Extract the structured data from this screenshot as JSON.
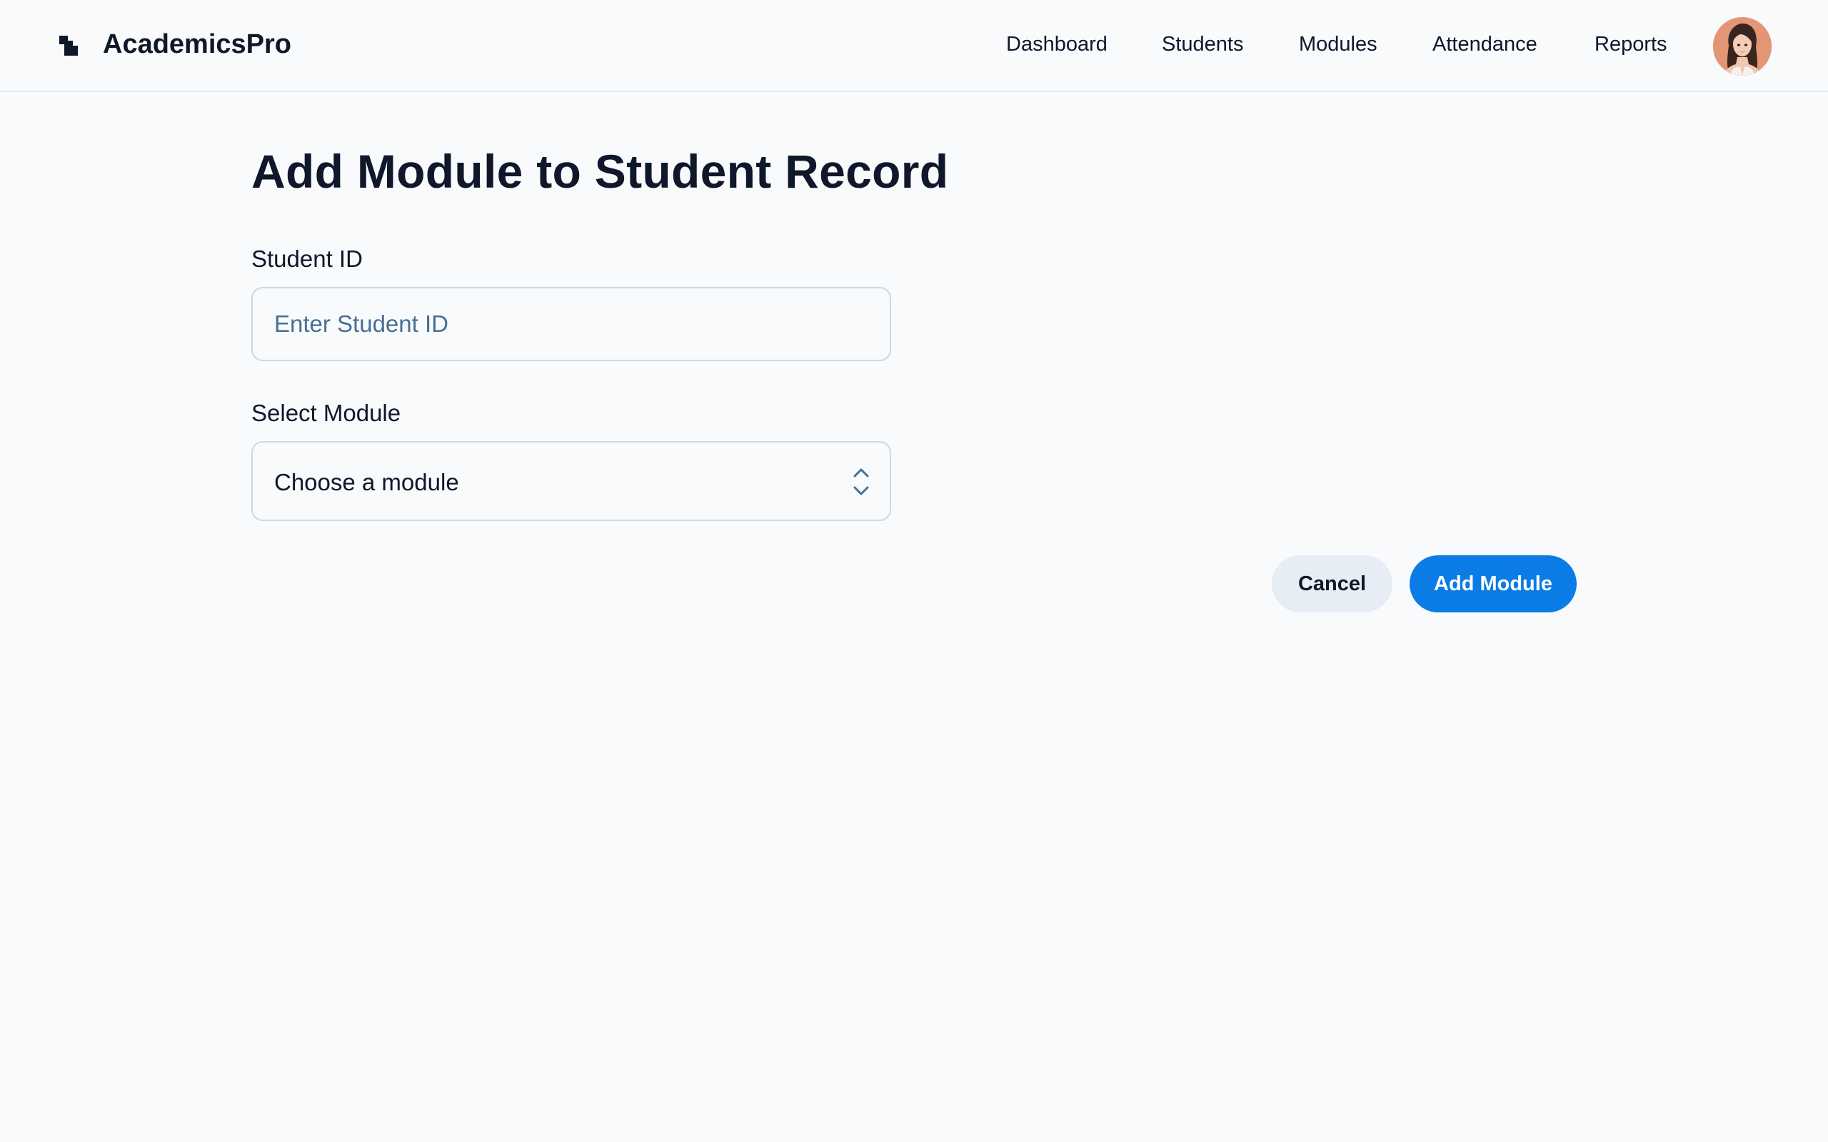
{
  "app": {
    "name": "AcademicsPro",
    "logo_icon": "stairs-logo-icon"
  },
  "nav": {
    "items": [
      {
        "label": "Dashboard"
      },
      {
        "label": "Students"
      },
      {
        "label": "Modules"
      },
      {
        "label": "Attendance"
      },
      {
        "label": "Reports"
      }
    ],
    "avatar_icon": "user-avatar"
  },
  "form": {
    "title": "Add Module to Student Record",
    "student_id": {
      "label": "Student ID",
      "placeholder": "Enter Student ID",
      "value": ""
    },
    "module": {
      "label": "Select Module",
      "selected": "Choose a module",
      "icon": "chevron-up-down-icon"
    },
    "cancel_label": "Cancel",
    "submit_label": "Add Module"
  },
  "colors": {
    "accent": "#0b7ce5",
    "background": "#f8fafc",
    "text": "#0f172a",
    "border": "#cbd8e6",
    "cancel_bg": "#e7edf4"
  }
}
